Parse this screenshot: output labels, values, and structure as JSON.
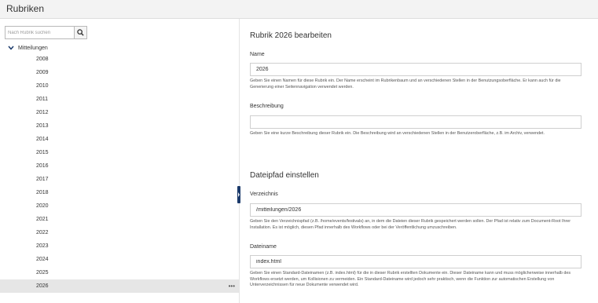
{
  "header": {
    "title": "Rubriken"
  },
  "sidebar": {
    "search": {
      "placeholder": "Nach Rubrik suchen",
      "icon": "search-icon"
    },
    "root": {
      "label": "Mitteilungen",
      "icon": "chevron-down-icon",
      "expanded": true
    },
    "items": [
      {
        "label": "2008"
      },
      {
        "label": "2009"
      },
      {
        "label": "2010"
      },
      {
        "label": "2011"
      },
      {
        "label": "2012"
      },
      {
        "label": "2013"
      },
      {
        "label": "2014"
      },
      {
        "label": "2015"
      },
      {
        "label": "2016"
      },
      {
        "label": "2017"
      },
      {
        "label": "2018"
      },
      {
        "label": "2020"
      },
      {
        "label": "2021"
      },
      {
        "label": "2022"
      },
      {
        "label": "2023"
      },
      {
        "label": "2024"
      },
      {
        "label": "2025"
      },
      {
        "label": "2026",
        "selected": true
      }
    ],
    "more_label": "•••"
  },
  "main": {
    "title": "Rubrik 2026 bearbeiten",
    "name": {
      "label": "Name",
      "value": "2026",
      "help": "Geben Sie einen Namen für diese Rubrik ein. Der Name erscheint im Rubrikenbaum und an verschiedenen Stellen in der Benutzungsoberfläche. Er kann auch für die Generierung einer Seitennavigation verwendet werden."
    },
    "description": {
      "label": "Beschreibung",
      "value": "",
      "help": "Geben Sie eine kurze Beschreibung dieser Rubrik ein. Die Beschreibung wird an verschiedenen Stellen in der Benutzeroberfläche, z.B. im Archiv, verwendet."
    },
    "section_title": "Dateipfad einstellen",
    "directory": {
      "label": "Verzeichnis",
      "value": "/mitteilungen/2026",
      "help": "Geben Sie den Verzeichnispfad (z.B. /home/events/festivals) an, in dem die Dateien dieser Rubrik gespeichert werden sollen. Der Pfad ist relativ zum Document-Root Ihrer Installation. Es ist möglich, diesen Pfad innerhalb des Workflows oder bei der Veröffentlichung umzuschreiben."
    },
    "filename": {
      "label": "Dateiname",
      "value": "index.html",
      "help": "Geben Sie einen Standard-Dateinamen (z.B. index.html) für die in dieser Rubrik erstellten Dokumente ein. Dieser Dateiname kann und muss möglicherweise innerhalb des Workflows ersetzt werden, um Kollisionen zu vermeiden. Ein Standard-Dateiname wird jedoch sehr praktisch, wenn die Funktion zur automatischen Erstellung von Unterverzeichnissen für neue Dokumente verwendet wird."
    }
  },
  "colors": {
    "splitter": "#1b3a6b",
    "selected_row": "#e6e6e6",
    "header_bg": "#f3f3f3"
  }
}
